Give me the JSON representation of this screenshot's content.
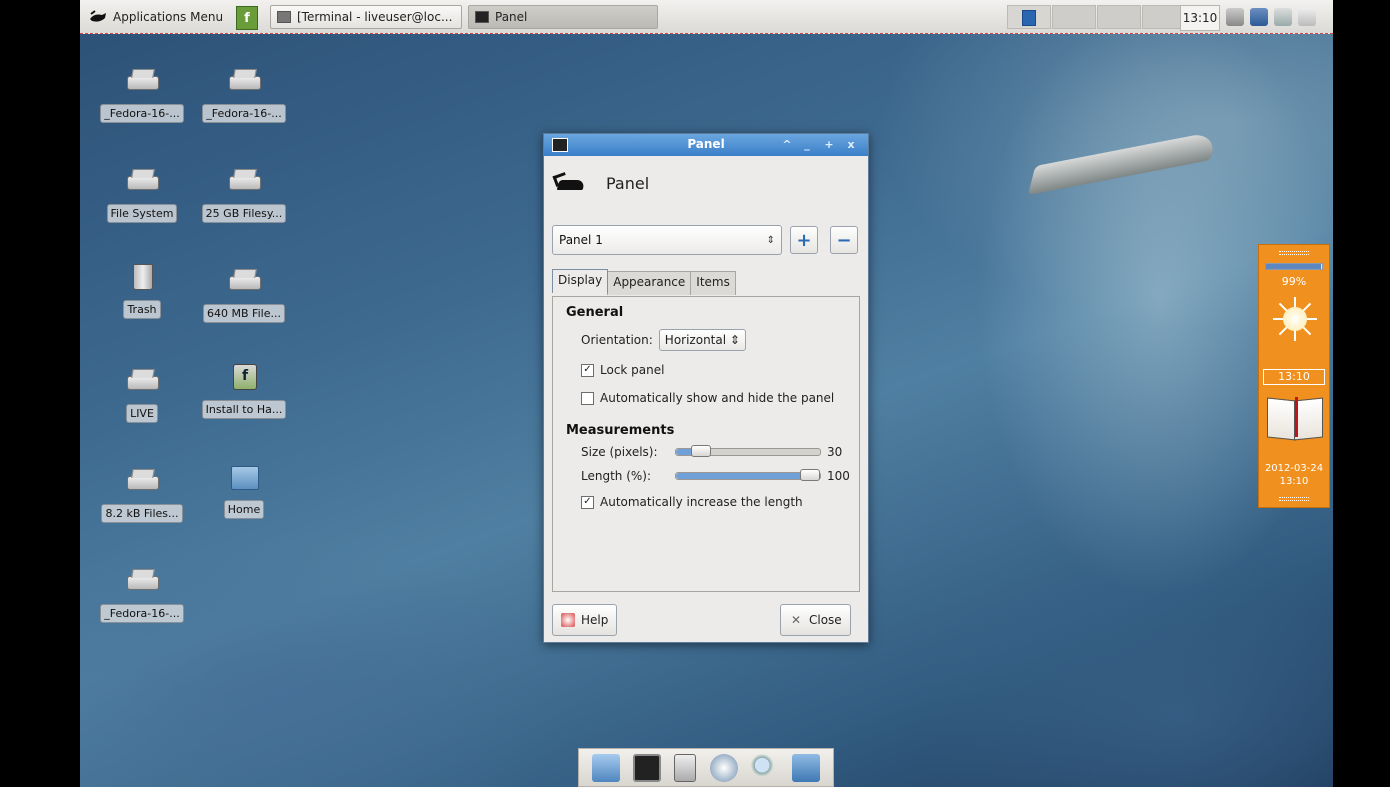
{
  "top_panel": {
    "apps_menu_label": "Applications Menu",
    "installer_launcher_glyph": "f",
    "tasks": [
      {
        "label": "[Terminal - liveuser@loc...",
        "icon": "terminal-window-icon"
      },
      {
        "label": "Panel",
        "icon": "panel-window-icon"
      }
    ],
    "clock": "13:10",
    "tray_icons": [
      "bluetooth-icon",
      "network-icon",
      "volume-icon",
      "power-icon"
    ]
  },
  "desktop_icons": [
    {
      "label": "_Fedora-16-...",
      "icon": "drive-icon"
    },
    {
      "label": "_Fedora-16-...",
      "icon": "drive-icon"
    },
    {
      "label": "File System",
      "icon": "drive-icon"
    },
    {
      "label": "25 GB Filesy...",
      "icon": "drive-icon"
    },
    {
      "label": "Trash",
      "icon": "trash-icon"
    },
    {
      "label": "640 MB File...",
      "icon": "drive-icon"
    },
    {
      "label": "LIVE",
      "icon": "drive-icon"
    },
    {
      "label": "Install to Ha...",
      "icon": "installer-icon"
    },
    {
      "label": "8.2 kB Files...",
      "icon": "drive-icon"
    },
    {
      "label": "Home",
      "icon": "home-folder-icon"
    },
    {
      "label": "_Fedora-16-...",
      "icon": "drive-icon"
    }
  ],
  "dialog": {
    "window_title": "Panel",
    "header_title": "Panel",
    "window_buttons": [
      "^",
      "_",
      "+",
      "x"
    ],
    "panel_select_value": "Panel 1",
    "add_label": "+",
    "remove_label": "−",
    "tabs": [
      "Display",
      "Appearance",
      "Items"
    ],
    "active_tab": "Display",
    "general": {
      "heading": "General",
      "orientation_label": "Orientation:",
      "orientation_value": "Horizontal",
      "lock_panel_label": "Lock panel",
      "lock_panel_checked": true,
      "autohide_label": "Automatically show and hide the panel",
      "autohide_checked": false
    },
    "measurements": {
      "heading": "Measurements",
      "size_label": "Size (pixels):",
      "size_value": "30",
      "size_fraction": 0.12,
      "length_label": "Length (%):",
      "length_value": "100",
      "length_fraction": 1.0,
      "auto_length_label": "Automatically increase the length",
      "auto_length_checked": true
    },
    "help_label": "Help",
    "close_label": "Close"
  },
  "side_widget": {
    "battery_percent": "99%",
    "battery_fraction": 0.99,
    "clock": "13:10",
    "date": "2012-03-24",
    "time": "13:10"
  },
  "dock": {
    "icons": [
      "file-manager-icon",
      "terminal-icon",
      "settings-icon",
      "web-browser-icon",
      "search-icon",
      "folder-icon"
    ]
  },
  "colors": {
    "titlebar": "#3a7fc8",
    "widget": "#f0901e"
  }
}
